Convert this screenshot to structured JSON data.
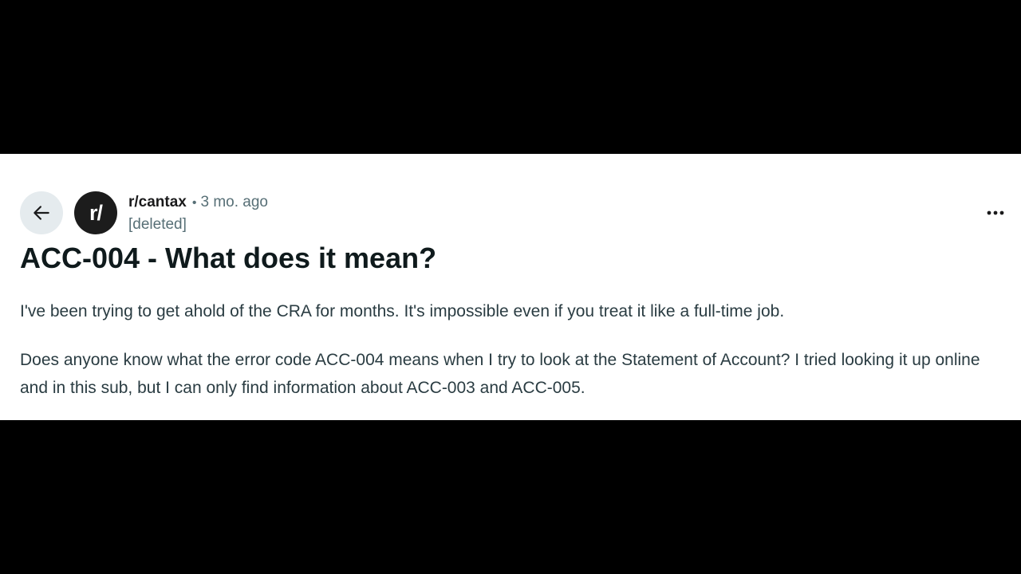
{
  "post": {
    "subreddit": "r/cantax",
    "separator": "•",
    "time_ago": "3 mo. ago",
    "author": "[deleted]",
    "avatar_text": "r/",
    "title": "ACC-004 - What does it mean?",
    "paragraphs": [
      "I've been trying to get ahold of the CRA for months. It's impossible even if you treat it like a full-time job.",
      "Does anyone know what the error code ACC-004 means when I try to look at the Statement of Account? I tried looking it up online and in this sub, but I can only find information about ACC-003 and ACC-005."
    ]
  },
  "icons": {
    "back": "arrow-left-icon",
    "more": "more-horizontal-icon"
  },
  "colors": {
    "letterbox": "#000000",
    "card_background": "#ffffff",
    "back_button_background": "#e5ebee",
    "avatar_background": "#1c1c1c",
    "title_text": "#0f1a1c",
    "body_text": "#2a3c42",
    "meta_text": "#576f76"
  }
}
